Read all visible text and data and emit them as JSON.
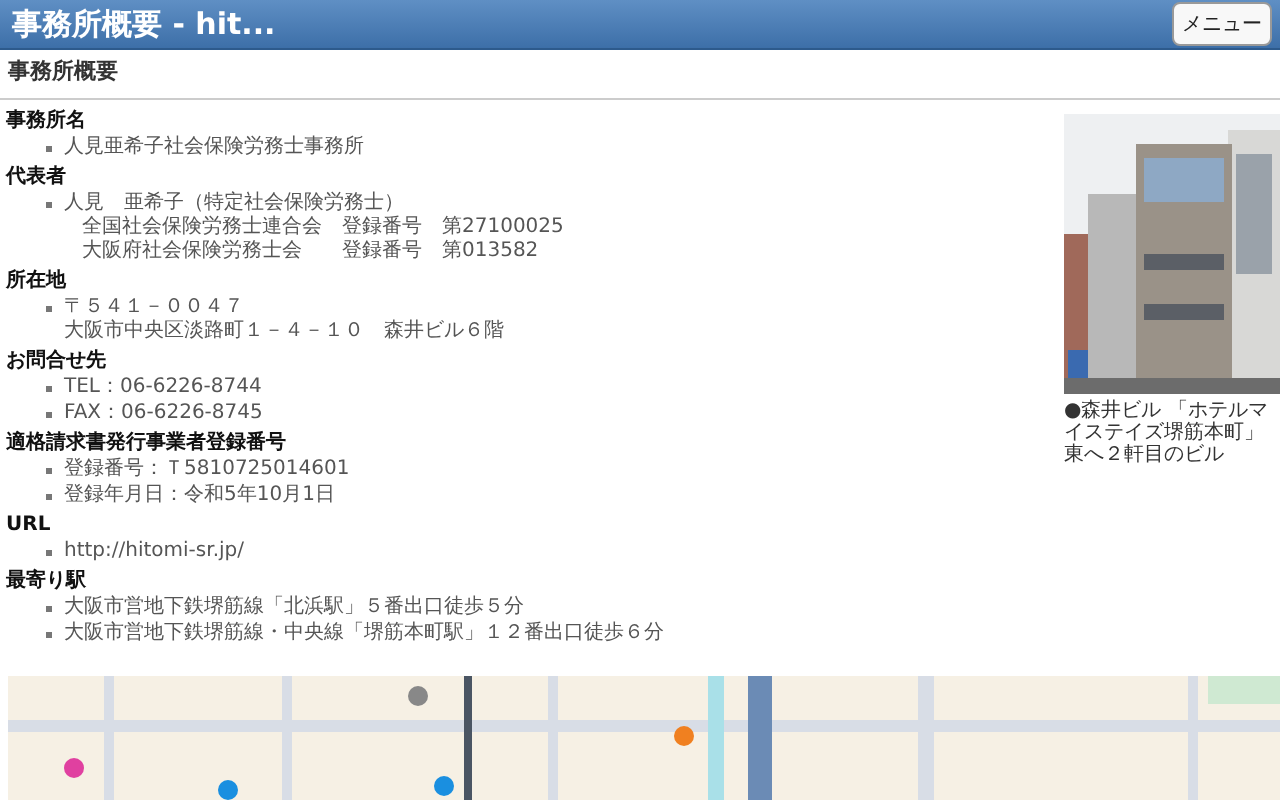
{
  "header": {
    "title": "事務所概要 - hit...",
    "menu_button": "メニュー"
  },
  "page_title": "事務所概要",
  "sections": [
    {
      "heading": "事務所名",
      "items": [
        {
          "lines": [
            "人見亜希子社会保険労務士事務所"
          ]
        }
      ]
    },
    {
      "heading": "代表者",
      "items": [
        {
          "lines": [
            "人見　亜希子（特定社会保険労務士）"
          ],
          "notes": [
            "全国社会保険労務士連合会　登録番号　第27100025",
            "大阪府社会保険労務士会　　登録番号　第013582"
          ]
        }
      ]
    },
    {
      "heading": "所在地",
      "items": [
        {
          "lines": [
            "〒５４１－００４７",
            "大阪市中央区淡路町１－４－１０　森井ビル６階"
          ]
        }
      ]
    },
    {
      "heading": "お問合せ先",
      "items": [
        {
          "lines": [
            "TEL：06-6226-8744"
          ]
        },
        {
          "lines": [
            "FAX：06-6226-8745"
          ]
        }
      ]
    },
    {
      "heading": "適格請求書発行事業者登録番号",
      "items": [
        {
          "lines": [
            "登録番号：Ｔ5810725014601"
          ]
        },
        {
          "lines": [
            "登録年月日：令和5年10月1日"
          ]
        }
      ]
    },
    {
      "heading": "URL",
      "items": [
        {
          "lines": [
            "http://hitomi-sr.jp/"
          ]
        }
      ]
    },
    {
      "heading": "最寄り駅",
      "items": [
        {
          "lines": [
            "大阪市営地下鉄堺筋線「北浜駅」５番出口徒歩５分"
          ]
        },
        {
          "lines": [
            "大阪市営地下鉄堺筋線・中央線「堺筋本町駅」１２番出口徒歩６分"
          ]
        }
      ]
    }
  ],
  "photo": {
    "kind": "picture",
    "caption": "●森井ビル 「ホテルマイステイズ堺筋本町」東へ２軒目のビル"
  }
}
